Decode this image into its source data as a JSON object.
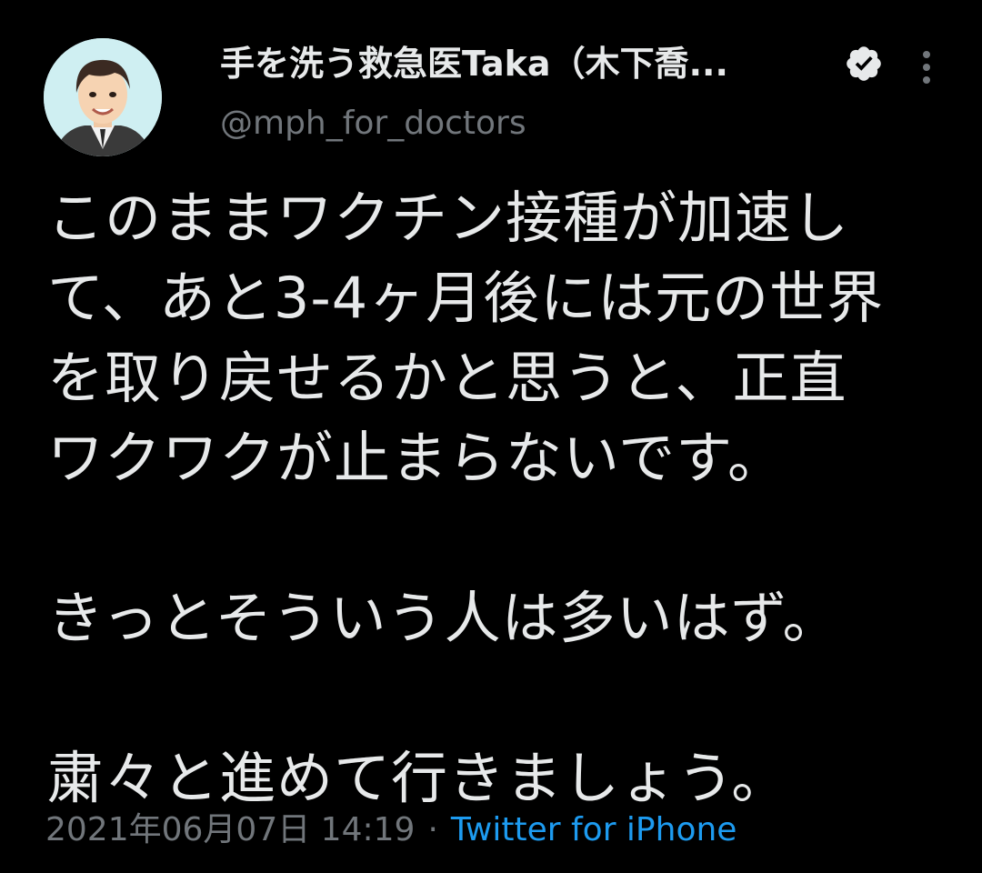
{
  "author": {
    "display_name": "手を洗う救急医Taka（木下喬...",
    "handle": "@mph_for_doctors",
    "verified": true
  },
  "tweet": {
    "lines": [
      "このままワクチン接種が加速し",
      "て、あと3-4ヶ月後には元の世界",
      "を取り戻せるかと思うと、正直",
      "ワクワクが止まらないです。",
      "",
      "きっとそういう人は多いはず。",
      "",
      "粛々と進めて行きましょう。"
    ],
    "timestamp": "2021年06月07日 14:19",
    "separator": "·",
    "source": "Twitter for iPhone"
  },
  "colors": {
    "background": "#000000",
    "text": "#e7e9ea",
    "secondary": "#71767b",
    "link": "#1d9bf0",
    "verified_badge": "#e7e9ea"
  },
  "icons": {
    "verified": "verified-badge-icon",
    "more": "more-vertical-icon"
  }
}
